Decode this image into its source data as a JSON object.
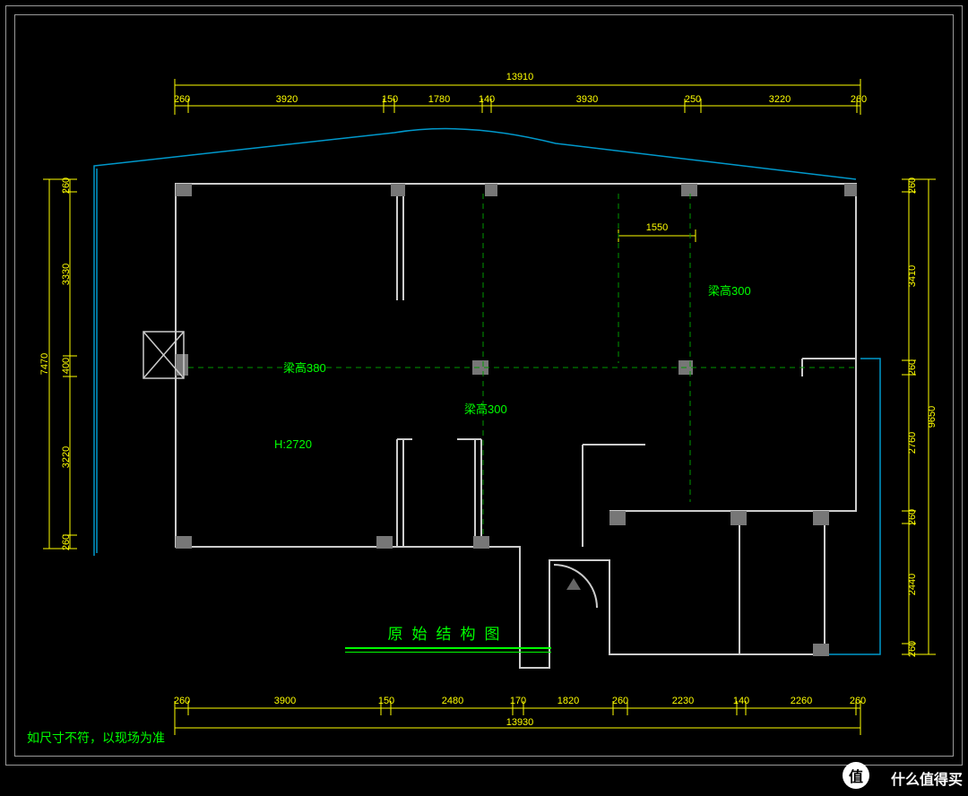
{
  "title": "原始结构图",
  "note": "如尺寸不符，以现场为准",
  "watermark": {
    "badge": "值",
    "text": "什么值得买"
  },
  "dimensions": {
    "top_total": "13910",
    "top_seg": [
      "260",
      "3920",
      "150",
      "1780",
      "140",
      "3930",
      "250",
      "3220",
      "260"
    ],
    "inner_top": "1550",
    "bottom_seg": [
      "260",
      "3900",
      "150",
      "2480",
      "170",
      "1820",
      "260",
      "2230",
      "140",
      "2260",
      "260"
    ],
    "bottom_total": "13930",
    "left_seg": [
      "260",
      "3330",
      "400",
      "3220",
      "260"
    ],
    "left_total": "7470",
    "right1_seg": [
      "260",
      "3410",
      "260",
      "2760",
      "260",
      "2440",
      "260"
    ],
    "right1_total": "9650"
  },
  "annotations": {
    "beam1": "梁高380",
    "beam2": "梁高300",
    "beam3": "梁高300",
    "height": "H:2720"
  },
  "colors": {
    "dim": "#ffff00",
    "anno": "#00ff00",
    "wall": "#cccccc",
    "outline": "#0099cc",
    "beam": "#007700"
  }
}
